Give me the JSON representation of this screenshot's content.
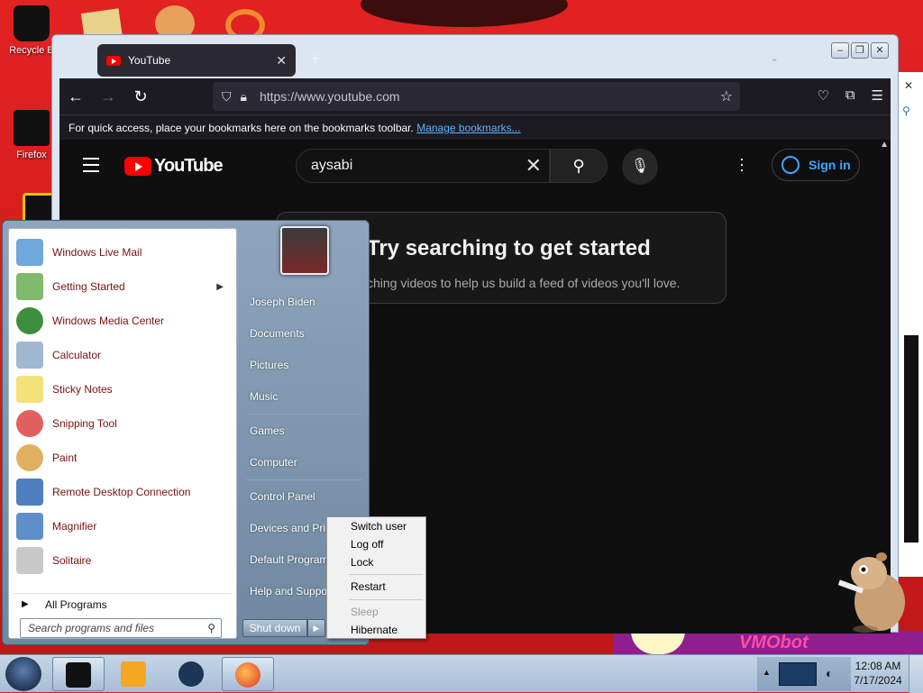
{
  "desktop": {
    "icons": [
      {
        "label": "Recycle B",
        "icon": "recycle-bin-icon"
      },
      {
        "label": "Firefox",
        "icon": "firefox-icon"
      }
    ],
    "bottom_art_text": "VMObot"
  },
  "browser": {
    "tab": {
      "title": "YouTube",
      "close": "✕"
    },
    "new_tab": "+",
    "url": "https://www.youtube.com",
    "bookmarks_text": "For quick access, place your bookmarks here on the bookmarks toolbar.",
    "bookmarks_link": "Manage bookmarks...",
    "window_buttons": [
      "–",
      "❐",
      "✕"
    ]
  },
  "youtube": {
    "logo_text": "YouTube",
    "search_value": "aysabi",
    "sign_in": "Sign in",
    "hint_title": "Try searching to get started",
    "hint_body": "ching videos to help us build a feed of videos you'll love."
  },
  "start_menu": {
    "programs": [
      {
        "label": "Windows Live Mail",
        "color": "#6fa8dc"
      },
      {
        "label": "Getting Started",
        "color": "#7fb96a",
        "submenu": true
      },
      {
        "label": "Windows Media Center",
        "color": "#3d8f3d"
      },
      {
        "label": "Calculator",
        "color": "#9fb8d0"
      },
      {
        "label": "Sticky Notes",
        "color": "#f3e27a"
      },
      {
        "label": "Snipping Tool",
        "color": "#e06060"
      },
      {
        "label": "Paint",
        "color": "#e0b060"
      },
      {
        "label": "Remote Desktop Connection",
        "color": "#4f7fc0"
      },
      {
        "label": "Magnifier",
        "color": "#5f8fc8"
      },
      {
        "label": "Solitaire",
        "color": "#c8c8c8"
      }
    ],
    "all_programs": "All Programs",
    "search_placeholder": "Search programs and files",
    "right_items": [
      "Joseph Biden",
      "Documents",
      "Pictures",
      "Music",
      "Games",
      "Computer",
      "Control Panel",
      "Devices and Prin",
      "Default Program",
      "Help and Suppo"
    ],
    "shutdown": "Shut down"
  },
  "power_menu": {
    "items": [
      {
        "label": "Switch user",
        "disabled": false
      },
      {
        "label": "Log off",
        "disabled": false
      },
      {
        "label": "Lock",
        "disabled": false
      },
      {
        "label": "Restart",
        "disabled": false
      },
      {
        "label": "Sleep",
        "disabled": true
      },
      {
        "label": "Hibernate",
        "disabled": false
      }
    ]
  },
  "taskbar": {
    "time": "12:08 AM",
    "date": "7/17/2024"
  }
}
